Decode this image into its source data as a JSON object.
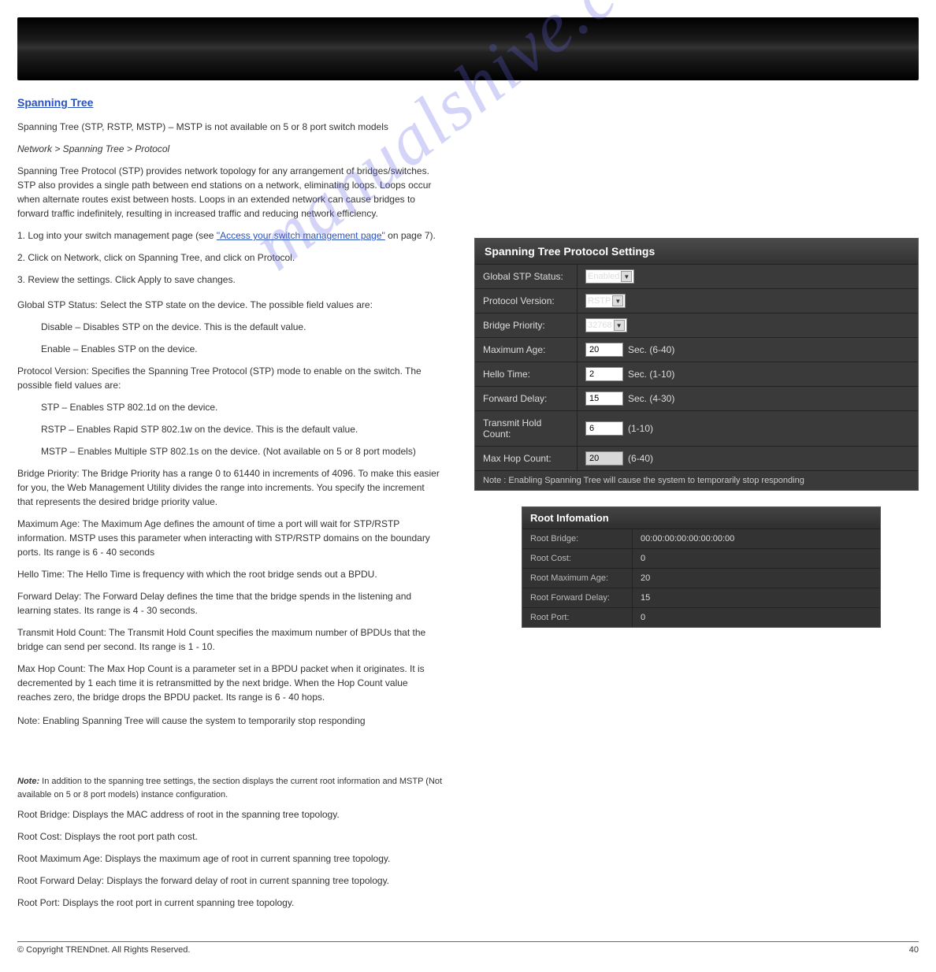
{
  "doc": {
    "section_title": "Spanning Tree",
    "intro": "Spanning Tree (STP, RSTP, MSTP) – MSTP is not available on 5 or 8 port switch models",
    "nav_heading": "Network > Spanning Tree > Protocol",
    "p1": "Spanning Tree Protocol (STP) provides network topology for any arrangement of bridges/switches. STP also provides a single path between end stations on a network, eliminating loops. Loops occur when alternate routes exist between hosts. Loops in an extended network can cause bridges to forward traffic indefinitely, resulting in increased traffic and reducing network efficiency.",
    "p2_a": "1. Log into your switch management page (see",
    "p2_link": "\"Access your switch management page\"",
    "p2_b": "on page 7).",
    "p3": "2. Click on Network, click on Spanning Tree, and click on Protocol.",
    "p4": "3. Review the settings. Click Apply to save changes.",
    "bullets": {
      "stp_status": "Global STP Status: Select the STP state on the device. The possible field values are:",
      "disable": "Disable – Disables STP on the device. This is the default value.",
      "enable": "Enable – Enables STP on the device.",
      "protocol_version": "Protocol Version: Specifies the Spanning Tree Protocol (STP) mode to enable on the switch. The possible field values are:",
      "stp": "STP – Enables STP 802.1d on the device.",
      "rstp": "RSTP – Enables Rapid STP 802.1w on the device. This is the default value.",
      "mstp": "MSTP – Enables Multiple STP 802.1s on the device. (Not available on 5 or 8 port models)",
      "bridge_priority": "Bridge Priority: The Bridge Priority has a range 0 to 61440 in increments of 4096. To make this easier for you, the Web Management Utility divides the range into increments. You specify the increment that represents the desired bridge priority value.",
      "max_age": "Maximum Age: The Maximum Age defines the amount of time a port will wait for STP/RSTP information. MSTP uses this parameter when interacting with STP/RSTP domains on the boundary ports. Its range is 6 - 40 seconds",
      "hello": "Hello Time: The Hello Time is frequency with which the root bridge sends out a BPDU.",
      "fwd": "Forward Delay: The Forward Delay defines the time that the bridge spends in the listening and learning states. Its range is 4 - 30 seconds.",
      "thc": "Transmit Hold Count: The Transmit Hold Count specifies the maximum number of BPDUs that the bridge can send per second. Its range is 1 - 10.",
      "mhc": "Max Hop Count: The Max Hop Count is a parameter set in a BPDU packet when it originates. It is decremented by 1 each time it is retransmitted by the next bridge. When the Hop Count value reaches zero, the bridge drops the BPDU packet. Its range is 6 - 40 hops."
    },
    "note": "Note: Enabling Spanning Tree will cause the system to temporarily stop responding",
    "note2_label": "Note:",
    "note2_text": " In addition to the spanning tree settings, the section displays the current root information and MSTP (Not available on 5 or 8 port models) instance configuration.",
    "root_bullets": {
      "bridge": "Root Bridge: Displays the MAC address of root in the spanning tree topology.",
      "cost": "Root Cost: Displays the root port path cost.",
      "max": "Root Maximum Age: Displays the maximum age of root in current spanning tree topology.",
      "fwd": "Root Forward Delay: Displays the forward delay of root in current spanning tree topology.",
      "port": "Root Port: Displays the root port in current spanning tree topology."
    }
  },
  "panel": {
    "title": "Spanning Tree Protocol Settings",
    "rows": {
      "stp_status": {
        "label": "Global STP Status:",
        "value": "Enabled"
      },
      "proto": {
        "label": "Protocol Version:",
        "value": "RSTP"
      },
      "priority": {
        "label": "Bridge Priority:",
        "value": "32768"
      },
      "maxage": {
        "label": "Maximum Age:",
        "value": "20",
        "range": "Sec. (6-40)"
      },
      "hello": {
        "label": "Hello Time:",
        "value": "2",
        "range": "Sec. (1-10)"
      },
      "fwd": {
        "label": "Forward Delay:",
        "value": "15",
        "range": "Sec. (4-30)"
      },
      "thc": {
        "label": "Transmit Hold Count:",
        "value": "6",
        "range": "(1-10)"
      },
      "mhc": {
        "label": "Max Hop Count:",
        "value": "20",
        "range": "(6-40)"
      }
    },
    "note": "Note : Enabling Spanning Tree will cause the system to temporarily stop responding"
  },
  "root": {
    "title": "Root Infomation",
    "rows": {
      "bridge": {
        "label": "Root Bridge:",
        "value": "00:00:00:00:00:00:00:00"
      },
      "cost": {
        "label": "Root Cost:",
        "value": "0"
      },
      "max": {
        "label": "Root Maximum Age:",
        "value": "20"
      },
      "fwd": {
        "label": "Root Forward Delay:",
        "value": "15"
      },
      "port": {
        "label": "Root Port:",
        "value": "0"
      }
    }
  },
  "footer": {
    "copyright": "© Copyright TRENDnet. All Rights Reserved.",
    "page": "40"
  }
}
